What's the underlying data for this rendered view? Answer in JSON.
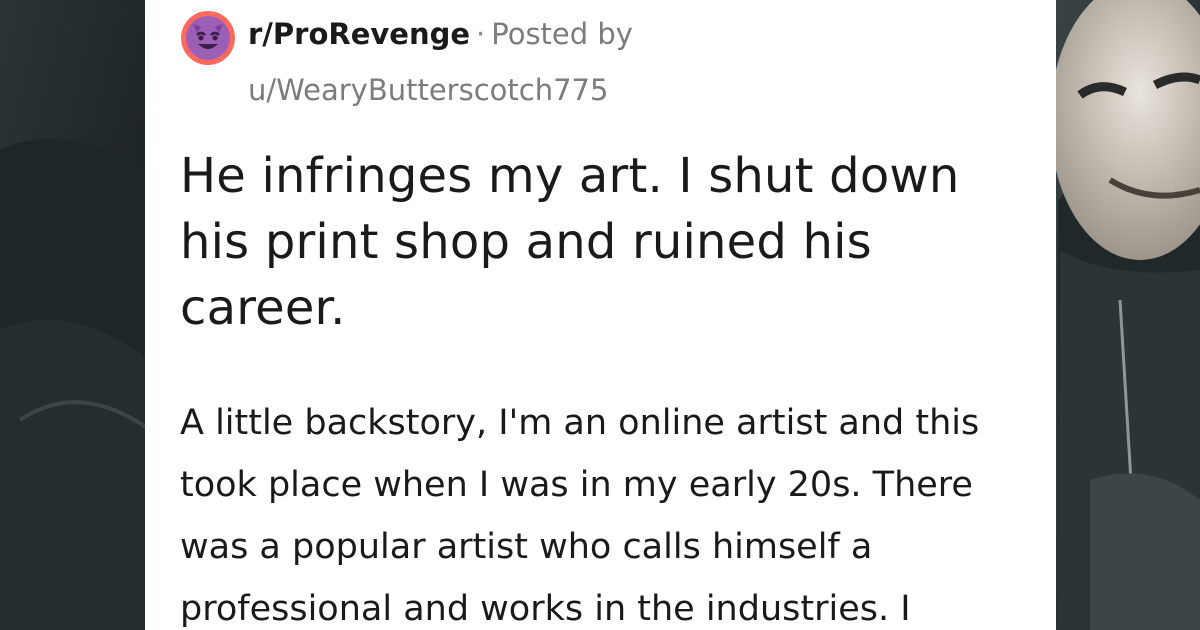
{
  "post": {
    "subreddit": "r/ProRevenge",
    "separator": "·",
    "posted_by_label": "Posted by",
    "username": "u/WearyButterscotch775",
    "title": "He infringes my art. I shut down his print shop and ruined his career.",
    "body": "A little backstory, I'm an online artist and this took place when I was in my early 20s. There was a popular artist who calls himself a professional and works in the industries. I"
  },
  "icons": {
    "subreddit_avatar": "smiling-devil-icon"
  },
  "colors": {
    "card_background": "#ffffff",
    "text_primary": "#1a1a1b",
    "text_meta": "#7c7c7c",
    "avatar_ring": "#ff6a5c",
    "avatar_face": "#9b5fb5"
  }
}
